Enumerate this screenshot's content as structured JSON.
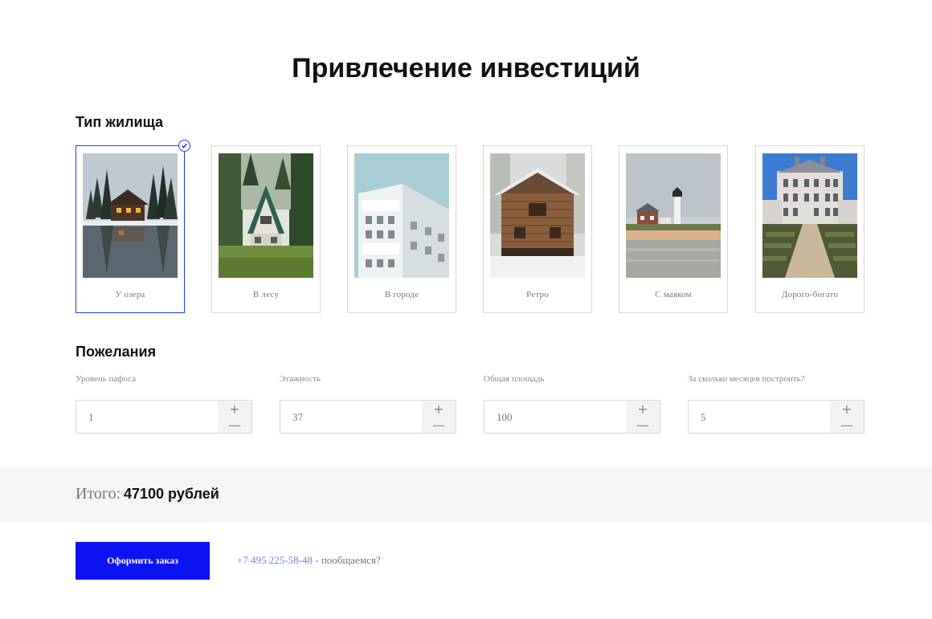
{
  "page_title": "Привлечение инвестиций",
  "housing": {
    "title": "Тип жилища",
    "options": [
      {
        "label": "У озера",
        "selected": true,
        "icon": "lake-cabin-photo"
      },
      {
        "label": "В лесу",
        "selected": false,
        "icon": "forest-aframe-photo"
      },
      {
        "label": "В городе",
        "selected": false,
        "icon": "city-building-photo"
      },
      {
        "label": "Ретро",
        "selected": false,
        "icon": "retro-log-house-photo"
      },
      {
        "label": "С маяком",
        "selected": false,
        "icon": "lighthouse-photo"
      },
      {
        "label": "Дорого-богато",
        "selected": false,
        "icon": "mansion-photo"
      }
    ]
  },
  "wishes": {
    "title": "Пожелания",
    "fields": [
      {
        "label": "Уровень пафоса",
        "value": "1"
      },
      {
        "label": "Этажность",
        "value": "37"
      },
      {
        "label": "Общая площадь",
        "value": "100"
      },
      {
        "label": "За сколько месяцев построить?",
        "value": "5"
      }
    ],
    "plus_symbol": "+",
    "minus_symbol": "—"
  },
  "total": {
    "label": "Итого:",
    "value": "47100 рублей"
  },
  "order_button": "Оформить заказ",
  "contact": {
    "phone": "+7 495 225-58-48",
    "suffix": " - пообщаемся?"
  },
  "colors": {
    "accent": "#0a14f0",
    "selection_border": "#1a3ef5",
    "phone_link": "#6a86d8",
    "band_bg": "#f5f5f5"
  }
}
